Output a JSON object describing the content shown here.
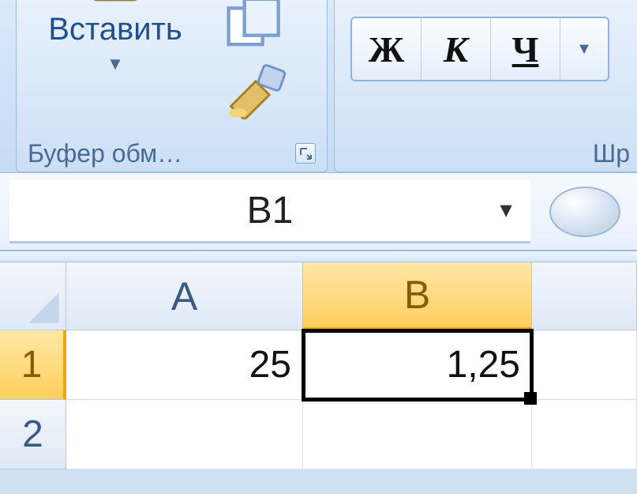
{
  "ribbon": {
    "clipboard": {
      "paste_label": "Вставить",
      "group_label": "Буфер обм…"
    },
    "font": {
      "bold": "Ж",
      "italic": "К",
      "underline": "Ч",
      "group_label": "Шр"
    }
  },
  "namebox": {
    "value": "B1"
  },
  "sheet": {
    "columns": [
      "A",
      "B"
    ],
    "selected_column": "B",
    "selected_row": "1",
    "rows": [
      {
        "num": "1",
        "A": "25",
        "B": "1,25"
      },
      {
        "num": "2",
        "A": "",
        "B": ""
      }
    ],
    "active_cell": "B1"
  }
}
